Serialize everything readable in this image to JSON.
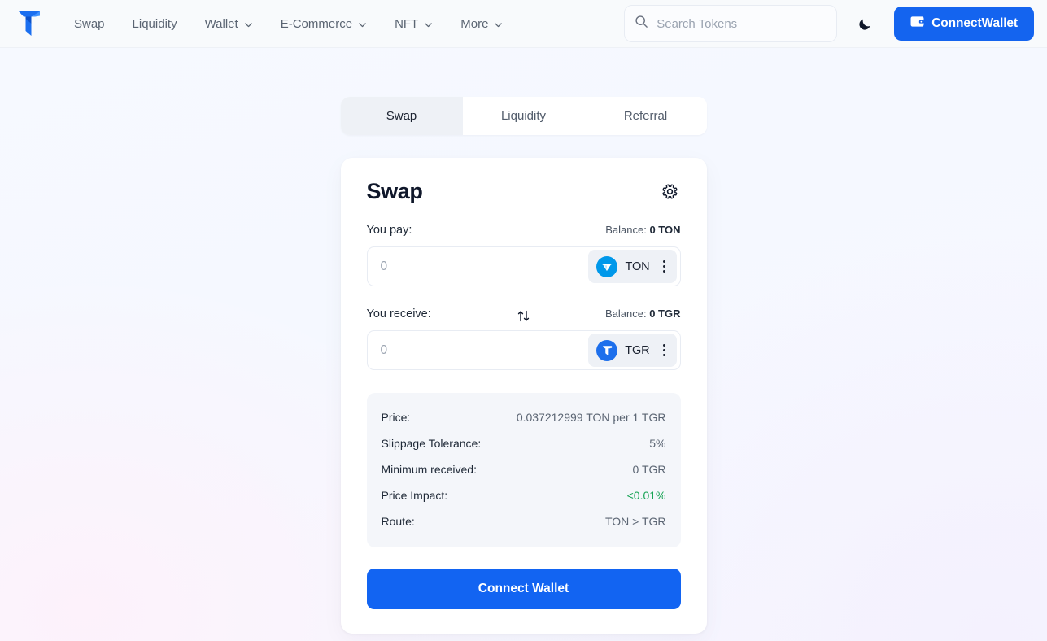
{
  "header": {
    "logo_name": "tegro-logo",
    "nav": [
      {
        "label": "Swap",
        "has_caret": false
      },
      {
        "label": "Liquidity",
        "has_caret": false
      },
      {
        "label": "Wallet",
        "has_caret": true
      },
      {
        "label": "E-Commerce",
        "has_caret": true
      },
      {
        "label": "NFT",
        "has_caret": true
      },
      {
        "label": "More",
        "has_caret": true
      }
    ],
    "search": {
      "placeholder": "Search Tokens",
      "value": ""
    },
    "theme_toggle_icon": "moon-icon",
    "connect_button": {
      "label": "ConnectWallet",
      "icon": "wallet-icon",
      "color": "#1464ef"
    }
  },
  "tabs": [
    {
      "label": "Swap",
      "active": true
    },
    {
      "label": "Liquidity",
      "active": false
    },
    {
      "label": "Referral",
      "active": false
    }
  ],
  "swap_card": {
    "title": "Swap",
    "settings_icon": "gear-icon",
    "pay": {
      "label": "You pay:",
      "balance_prefix": "Balance: ",
      "balance_value": "0 TON",
      "amount_value": "",
      "amount_placeholder": "0",
      "token_symbol": "TON",
      "token_icon": "ton-coin-icon",
      "token_color": "#0098ea",
      "menu_icon": "kebab-menu-icon"
    },
    "switch_icon": "swap-vertical-icon",
    "receive": {
      "label": "You receive:",
      "balance_prefix": "Balance: ",
      "balance_value": "0 TGR",
      "amount_value": "",
      "amount_placeholder": "0",
      "token_symbol": "TGR",
      "token_icon": "tgr-coin-icon",
      "token_color": "#1d6fec",
      "menu_icon": "kebab-menu-icon"
    },
    "info": [
      {
        "key": "Price:",
        "value": "0.037212999 TON per 1 TGR",
        "color": "#5b6573"
      },
      {
        "key": "Slippage Tolerance:",
        "value": "5%",
        "color": "#5b6573"
      },
      {
        "key": "Minimum received:",
        "value": "0 TGR",
        "color": "#5b6573"
      },
      {
        "key": "Price Impact:",
        "value": "<0.01%",
        "color": "#17a354"
      },
      {
        "key": "Route:",
        "value": "TON > TGR",
        "color": "#5b6573"
      }
    ],
    "cta_label": "Connect Wallet"
  }
}
